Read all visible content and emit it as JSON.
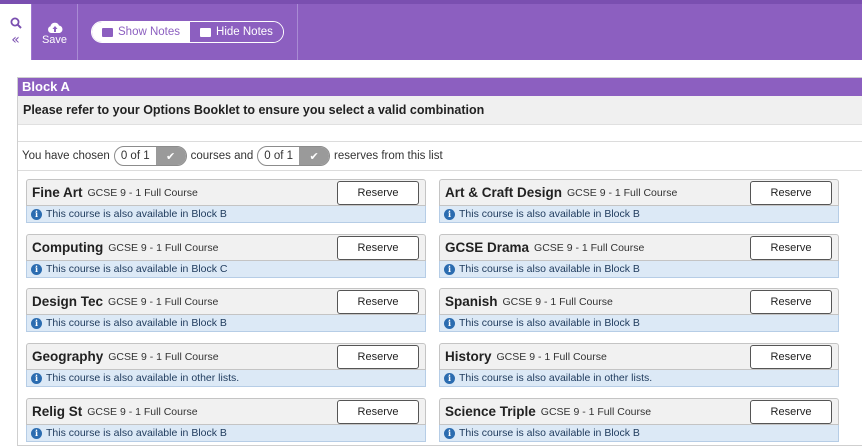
{
  "toolbar": {
    "search_icon": "magnifier-icon",
    "collapse_icon": "double-chevron-left-icon",
    "save_label": "Save",
    "show_notes_label": "Show Notes",
    "hide_notes_label": "Hide Notes"
  },
  "block": {
    "title": "Block A",
    "instruction": "Please refer to your Options Booklet to ensure you select a valid combination",
    "chosen_prefix": "You have chosen",
    "courses_count": "0 of 1",
    "middle_text": "courses and",
    "reserves_count": "0 of 1",
    "suffix_text": "reserves from this list"
  },
  "colors": {
    "accent": "#8c5fc0",
    "note_bg": "#dce9f6",
    "info_icon": "#2b6cb0"
  },
  "courses": [
    {
      "name": "Fine Art",
      "type": "GCSE 9 - 1 Full Course",
      "note": "This course is also available in Block B",
      "reserve_label": "Reserve"
    },
    {
      "name": "Art & Craft Design",
      "type": "GCSE 9 - 1 Full Course",
      "note": "This course is also available in Block B",
      "reserve_label": "Reserve"
    },
    {
      "name": "Computing",
      "type": "GCSE 9 - 1 Full Course",
      "note": "This course is also available in Block C",
      "reserve_label": "Reserve"
    },
    {
      "name": "GCSE Drama",
      "type": "GCSE 9 - 1 Full Course",
      "note": "This course is also available in Block B",
      "reserve_label": "Reserve"
    },
    {
      "name": "Design Tec",
      "type": "GCSE 9 - 1 Full Course",
      "note": "This course is also available in Block B",
      "reserve_label": "Reserve"
    },
    {
      "name": "Spanish",
      "type": "GCSE 9 - 1 Full Course",
      "note": "This course is also available in Block B",
      "reserve_label": "Reserve"
    },
    {
      "name": "Geography",
      "type": "GCSE 9 - 1 Full Course",
      "note": "This course is also available in other lists.",
      "reserve_label": "Reserve"
    },
    {
      "name": "History",
      "type": "GCSE 9 - 1 Full Course",
      "note": "This course is also available in other lists.",
      "reserve_label": "Reserve"
    },
    {
      "name": "Relig St",
      "type": "GCSE 9 - 1 Full Course",
      "note": "This course is also available in Block B",
      "reserve_label": "Reserve"
    },
    {
      "name": "Science Triple",
      "type": "GCSE 9 - 1 Full Course",
      "note": "This course is also available in Block B",
      "reserve_label": "Reserve"
    }
  ]
}
